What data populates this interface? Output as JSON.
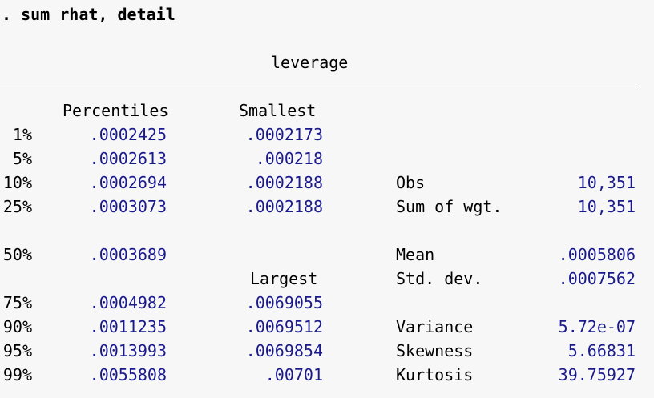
{
  "command": ". sum rhat, detail",
  "variable": "leverage",
  "headers": {
    "percentiles": "Percentiles",
    "smallest": "Smallest",
    "largest": "Largest"
  },
  "rows": [
    {
      "pct": "1%",
      "pval": ".0002425",
      "ext": ".0002173",
      "stat_label": "",
      "stat_value": ""
    },
    {
      "pct": "5%",
      "pval": ".0002613",
      "ext": ".000218",
      "stat_label": "",
      "stat_value": ""
    },
    {
      "pct": "10%",
      "pval": ".0002694",
      "ext": ".0002188",
      "stat_label": "Obs",
      "stat_value": "10,351"
    },
    {
      "pct": "25%",
      "pval": ".0003073",
      "ext": ".0002188",
      "stat_label": "Sum of wgt.",
      "stat_value": "10,351"
    },
    {
      "pct": "50%",
      "pval": ".0003689",
      "ext": "",
      "stat_label": "Mean",
      "stat_value": ".0005806"
    },
    {
      "pct": "",
      "pval": "",
      "ext": "",
      "stat_label": "Std. dev.",
      "stat_value": ".0007562"
    },
    {
      "pct": "75%",
      "pval": ".0004982",
      "ext": ".0069055",
      "stat_label": "",
      "stat_value": ""
    },
    {
      "pct": "90%",
      "pval": ".0011235",
      "ext": ".0069512",
      "stat_label": "Variance",
      "stat_value": "5.72e-07"
    },
    {
      "pct": "95%",
      "pval": ".0013993",
      "ext": ".0069854",
      "stat_label": "Skewness",
      "stat_value": "5.66831"
    },
    {
      "pct": "99%",
      "pval": ".0055808",
      "ext": ".00701",
      "stat_label": "Kurtosis",
      "stat_value": "39.75927"
    }
  ]
}
